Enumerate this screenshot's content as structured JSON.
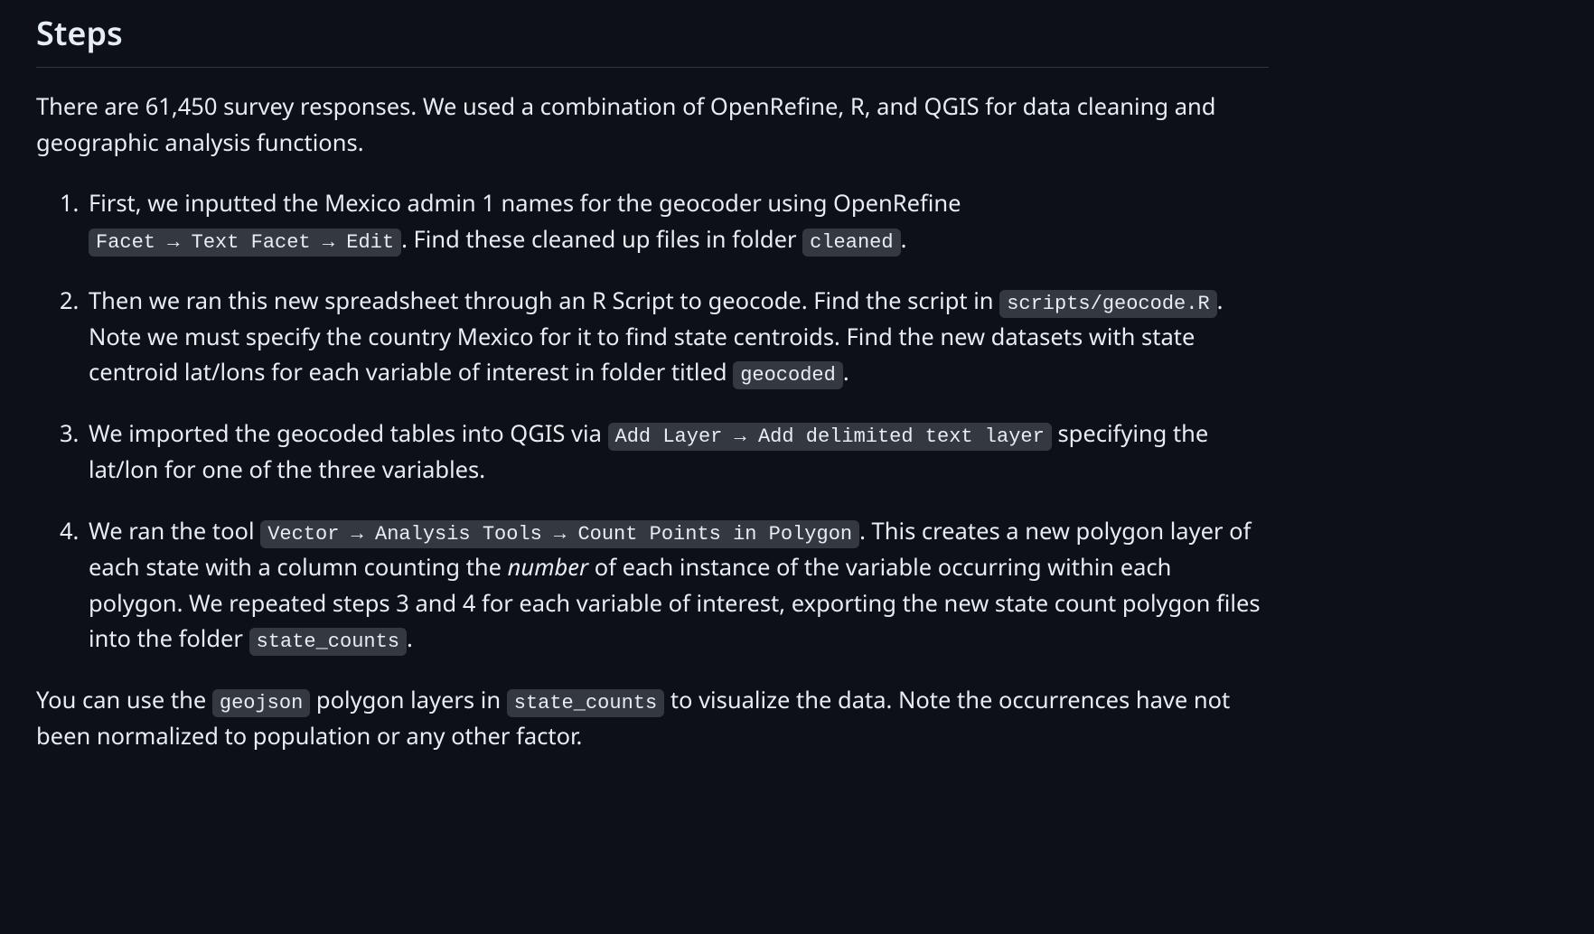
{
  "heading": "Steps",
  "intro": "There are 61,450 survey responses. We used a combination of OpenRefine, R, and QGIS for data cleaning and geographic analysis functions.",
  "steps": [
    {
      "pre1": "First, we inputted the Mexico admin 1 names for the geocoder using OpenRefine ",
      "code1": "Facet → Text Facet → Edit",
      "mid1": ". Find these cleaned up files in folder ",
      "code2": "cleaned",
      "after": "."
    },
    {
      "pre1": "Then we ran this new spreadsheet through an R Script to geocode. Find the script in ",
      "code1": "scripts/geocode.R",
      "mid1": ". Note we must specify the country Mexico for it to find state centroids. Find the new datasets with state centroid lat/lons for each variable of interest in folder titled ",
      "code2": "geocoded",
      "after": "."
    },
    {
      "pre1": "We imported the geocoded tables into QGIS via ",
      "code1": "Add Layer → Add delimited text layer",
      "mid1": " specifying the lat/lon for one of the three variables.",
      "code2": "",
      "after": ""
    },
    {
      "pre1": "We ran the tool ",
      "code1": "Vector → Analysis Tools → Count Points in Polygon",
      "mid1": ". This creates a new polygon layer of each state with a column counting the ",
      "em1": "number",
      "mid2": " of each instance of the variable occurring within each polygon. We repeated steps 3 and 4 for each variable of interest, exporting the new state count polygon files into the folder ",
      "code2": "state_counts",
      "after": "."
    }
  ],
  "outro_pre1": "You can use the ",
  "outro_code1": "geojson",
  "outro_mid1": " polygon layers in ",
  "outro_code2": "state_counts",
  "outro_after": " to visualize the data. Note the occurrences have not been normalized to population or any other factor."
}
